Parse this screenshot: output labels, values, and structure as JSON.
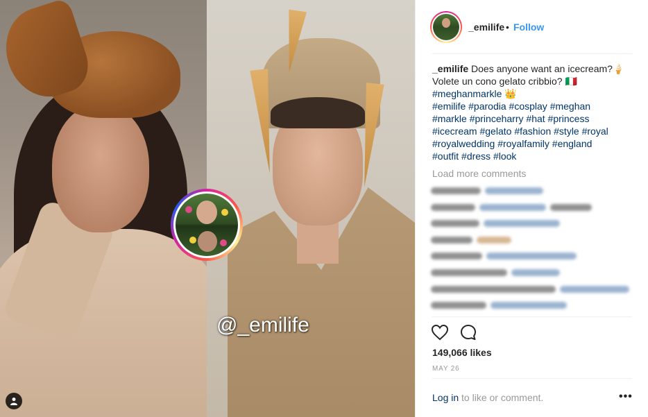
{
  "post": {
    "watermark": "@_emilife",
    "username": "_emilife",
    "separator": "•",
    "follow_label": "Follow"
  },
  "caption": {
    "username": "_emilife",
    "line1": "Does anyone want an icecream?🍦",
    "line2": "Volete un cono gelato cribbio? 🇮🇹",
    "line3_tag": "#meghanmarkle",
    "line3_emoji": "👑",
    "hashtags": [
      [
        "#emilife",
        "#parodia",
        "#cosplay",
        "#meghan"
      ],
      [
        "#markle",
        "#princeharry",
        "#hat",
        "#princess"
      ],
      [
        "#icecream",
        "#gelato",
        "#fashion",
        "#style",
        "#royal"
      ],
      [
        "#royalwedding",
        "#royalfamily",
        "#england"
      ],
      [
        "#outfit",
        "#dress",
        "#look"
      ]
    ]
  },
  "comments": {
    "load_more": "Load more comments"
  },
  "stats": {
    "likes": "149,066 likes",
    "date": "MAY 26"
  },
  "footer": {
    "login_link": "Log in",
    "login_rest": " to like or comment.",
    "more": "•••"
  },
  "icons": {
    "like": "heart-icon",
    "comment": "comment-icon",
    "tag": "user-tag-icon"
  }
}
